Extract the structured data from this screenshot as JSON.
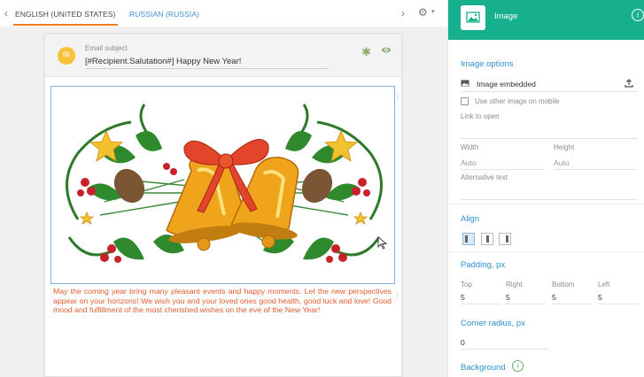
{
  "tabs": [
    {
      "label": "ENGLISH (UNITED STATES)",
      "active": true
    },
    {
      "label": "RUSSIAN (RUSSIA)",
      "active": false
    }
  ],
  "nav": {
    "prev_icon": "chevron-left-icon",
    "next_icon": "chevron-right-icon",
    "settings_icon": "gear-icon"
  },
  "email": {
    "subject_label": "Email subject",
    "subject_value": "[#Recipient.Salutation#] Happy New Year!",
    "message": "May the coming year bring many pleasant events and happy moments. Let the new perspectives appear on your horizons! We wish you and your loved ones good health, good luck and love! Good mood and fulfillment of the most cherished wishes on the eve of the New Year!",
    "message_color": "#e25a2b"
  },
  "panel": {
    "title": "Image",
    "info_icon": "info-icon",
    "image_options_title": "Image options",
    "image_name": "Image embedded",
    "use_other_mobile_label": "Use other image on mobile",
    "use_other_mobile_checked": false,
    "link_label": "Link to open",
    "link_value": "",
    "width_label": "Width",
    "width_value": "Auto",
    "height_label": "Height",
    "height_value": "Auto",
    "alt_label": "Alternative text",
    "alt_value": "",
    "align_title": "Align",
    "align_options": [
      "left",
      "center",
      "right"
    ],
    "align_selected": "left",
    "padding_title": "Padding, px",
    "padding": [
      {
        "label": "Top",
        "value": "5"
      },
      {
        "label": "Right",
        "value": "5"
      },
      {
        "label": "Bottom",
        "value": "5"
      },
      {
        "label": "Left",
        "value": "5"
      }
    ],
    "corner_title": "Corner radius, px",
    "corner_value": "0",
    "background_title": "Background"
  },
  "colors": {
    "accent": "#17b08e",
    "section_title": "#2e8fcf",
    "tab_active_underline": "#f47b20",
    "tab_link": "#3d8fd6"
  }
}
